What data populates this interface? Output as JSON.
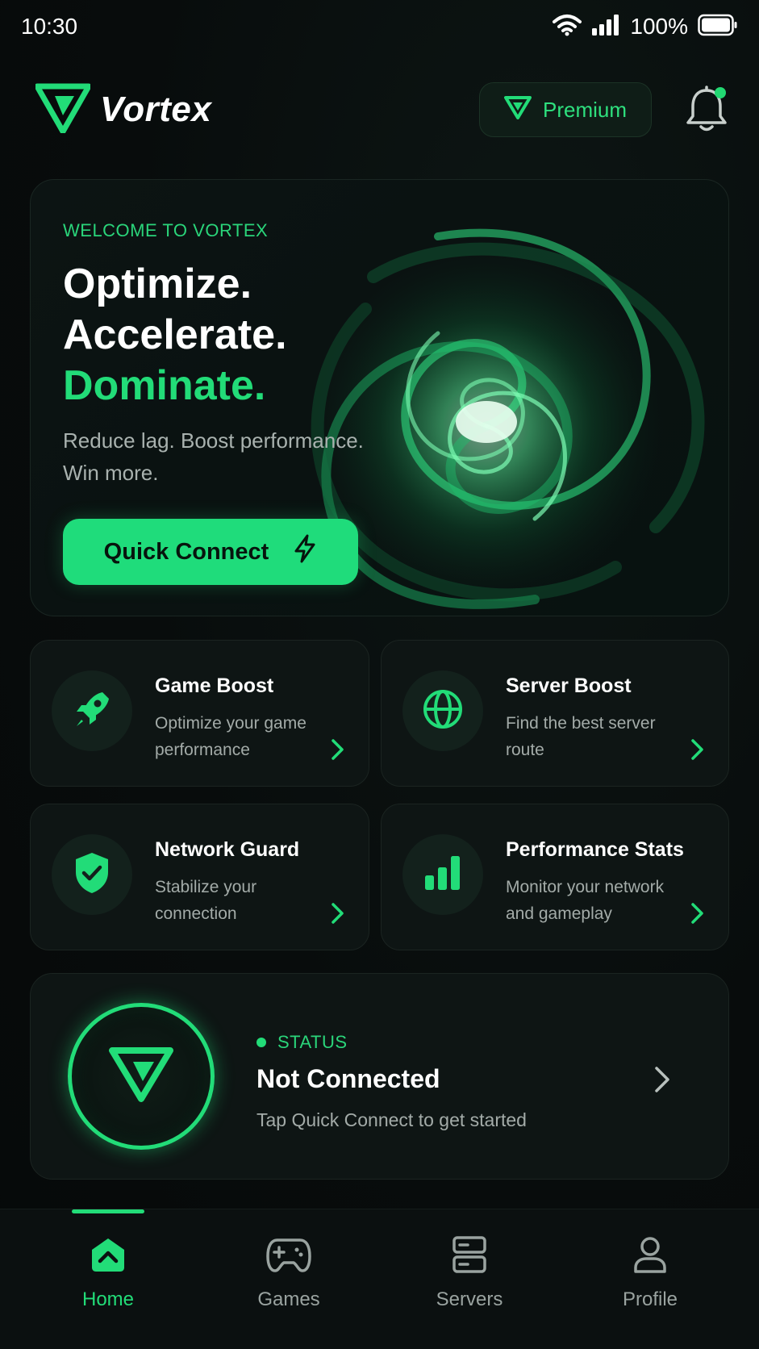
{
  "status_bar": {
    "time": "10:30",
    "battery": "100%"
  },
  "header": {
    "brand": "Vortex",
    "premium_label": "Premium"
  },
  "hero": {
    "kicker": "WELCOME TO VORTEX",
    "line1": "Optimize.",
    "line2": "Accelerate.",
    "line3": "Dominate.",
    "sub1": "Reduce lag. Boost performance.",
    "sub2": "Win more.",
    "cta": "Quick Connect"
  },
  "features": [
    {
      "title": "Game Boost",
      "desc": "Optimize your game performance",
      "icon": "rocket-icon"
    },
    {
      "title": "Server Boost",
      "desc": "Find the best server route",
      "icon": "globe-icon"
    },
    {
      "title": "Network Guard",
      "desc": "Stabilize your connection",
      "icon": "shield-check-icon"
    },
    {
      "title": "Performance Stats",
      "desc": "Monitor your network and gameplay",
      "icon": "bar-chart-icon"
    }
  ],
  "status": {
    "label": "STATUS",
    "title": "Not Connected",
    "desc": "Tap Quick Connect to get started"
  },
  "nav": [
    {
      "label": "Home",
      "icon": "home-icon",
      "active": true
    },
    {
      "label": "Games",
      "icon": "gamepad-icon",
      "active": false
    },
    {
      "label": "Servers",
      "icon": "server-icon",
      "active": false
    },
    {
      "label": "Profile",
      "icon": "user-icon",
      "active": false
    }
  ],
  "colors": {
    "accent": "#22dc78",
    "background": "#070b0b",
    "card": "#0e1514"
  }
}
